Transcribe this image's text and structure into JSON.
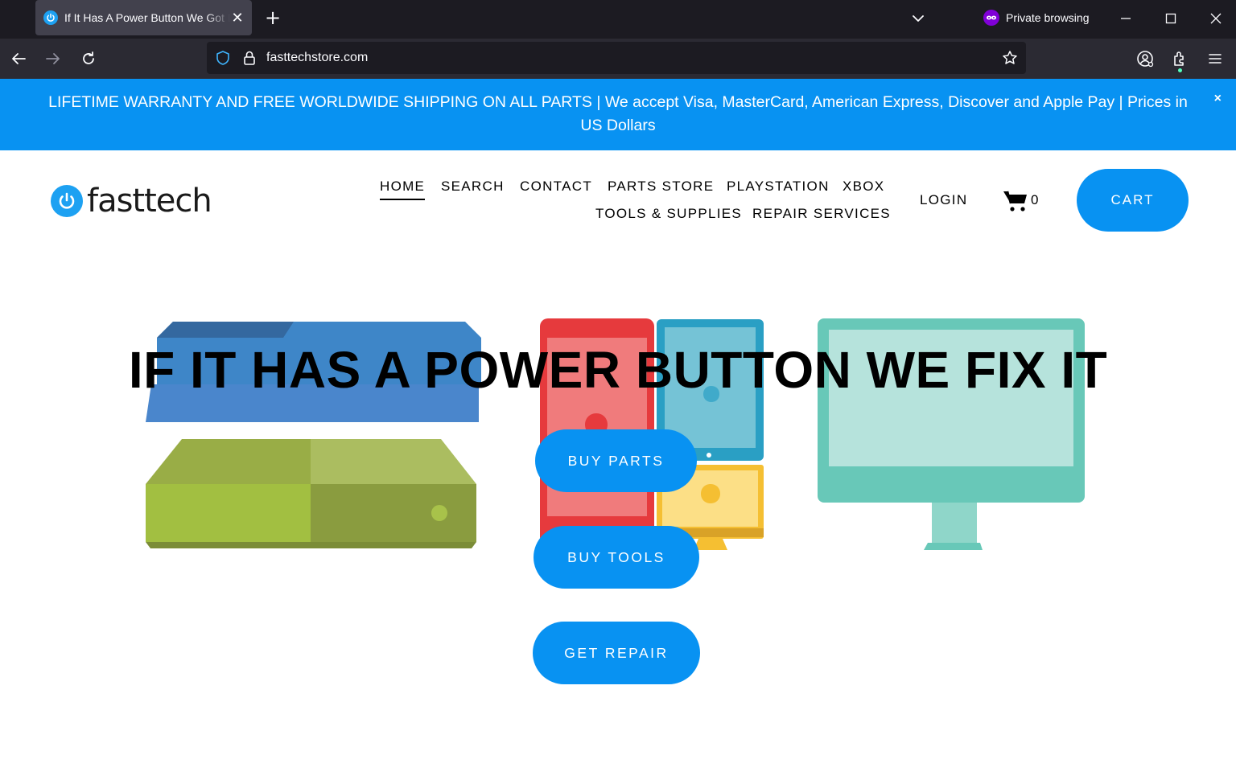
{
  "browser": {
    "tab_title": "If It Has A Power Button We Got It",
    "private_label": "Private browsing",
    "url": "fasttechstore.com"
  },
  "announcement": {
    "text": "LIFETIME WARRANTY AND FREE WORLDWIDE SHIPPING ON ALL PARTS | We accept Visa, MasterCard, American Express, Discover and Apple Pay | Prices in US Dollars",
    "close": "×"
  },
  "header": {
    "logo_text": "fasttech",
    "nav": [
      {
        "label": "HOME",
        "active": true
      },
      {
        "label": "SEARCH"
      },
      {
        "label": "CONTACT"
      },
      {
        "label": "PARTS STORE"
      },
      {
        "label": "PLAYSTATION"
      },
      {
        "label": "XBOX"
      },
      {
        "label": "TOOLS & SUPPLIES"
      },
      {
        "label": "REPAIR SERVICES"
      }
    ],
    "login_label": "LOGIN",
    "cart_count": "0",
    "cart_button": "CART"
  },
  "hero": {
    "title": "IF IT HAS A POWER BUTTON WE FIX IT",
    "buttons": [
      "BUY PARTS",
      "BUY TOOLS",
      "GET REPAIR"
    ]
  },
  "colors": {
    "brand_blue": "#0892f2",
    "logo_blue": "#1da1f2",
    "chrome_dark": "#1c1b22",
    "private_purple": "#8000d7"
  },
  "icons": [
    "power-icon",
    "tab-close-icon",
    "plus-icon",
    "chevron-down-icon",
    "private-mask-icon",
    "minimize-icon",
    "maximize-icon",
    "window-close-icon",
    "back-arrow-icon",
    "forward-arrow-icon",
    "reload-icon",
    "shield-icon",
    "lock-icon",
    "star-icon",
    "account-icon",
    "extensions-icon",
    "menu-icon",
    "cart-icon"
  ]
}
